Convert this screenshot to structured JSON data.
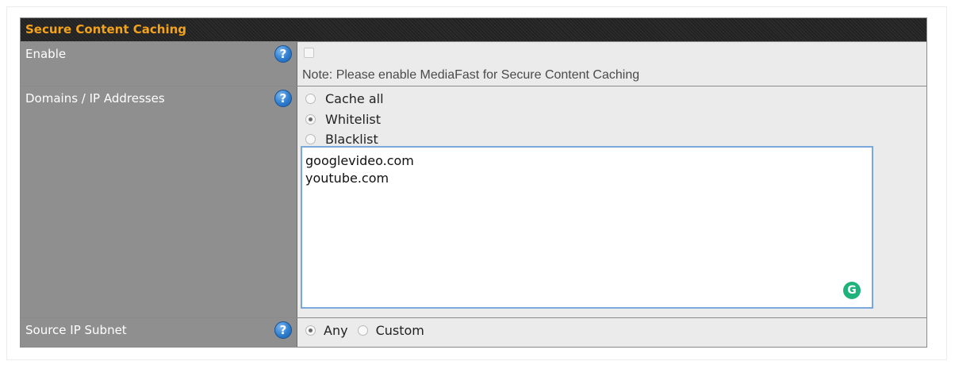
{
  "section": {
    "title": "Secure Content Caching"
  },
  "rows": {
    "enable": {
      "label": "Enable",
      "help_icon": "help-icon",
      "checked": false,
      "note": "Note: Please enable MediaFast for Secure Content Caching"
    },
    "domains": {
      "label": "Domains / IP Addresses",
      "help_icon": "help-icon",
      "options": [
        "Cache all",
        "Whitelist",
        "Blacklist"
      ],
      "selected": "Whitelist",
      "entries": [
        "googlevideo.com",
        "youtube.com"
      ],
      "assistant_icon": "grammarly-icon",
      "assistant_glyph": "G"
    },
    "source": {
      "label": "Source IP Subnet",
      "help_icon": "help-icon",
      "options": [
        "Any",
        "Custom"
      ],
      "selected": "Any"
    }
  },
  "help_glyph": "?",
  "colors": {
    "header_text": "#f5a21b",
    "label_bg": "#8f8f8f",
    "value_bg": "#ebebeb",
    "help_icon": "#2f7dcf",
    "textarea_border": "#7aa7dc",
    "grammarly": "#1fb27a"
  }
}
